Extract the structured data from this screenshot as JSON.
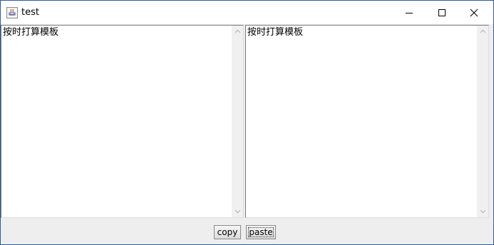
{
  "window": {
    "title": "test",
    "icon": "java-app-icon",
    "controls": [
      "minimize-icon",
      "maximize-icon",
      "close-icon"
    ]
  },
  "panes": {
    "left": {
      "text": "按时打算模板"
    },
    "right": {
      "text": "按时打算模板"
    }
  },
  "buttons": {
    "copy_label": "copy",
    "paste_label": "paste"
  },
  "colors": {
    "window_border": "#2f5a9a",
    "panel_background": "#eeeeee",
    "scrollbar_track": "#f0f0f0"
  }
}
